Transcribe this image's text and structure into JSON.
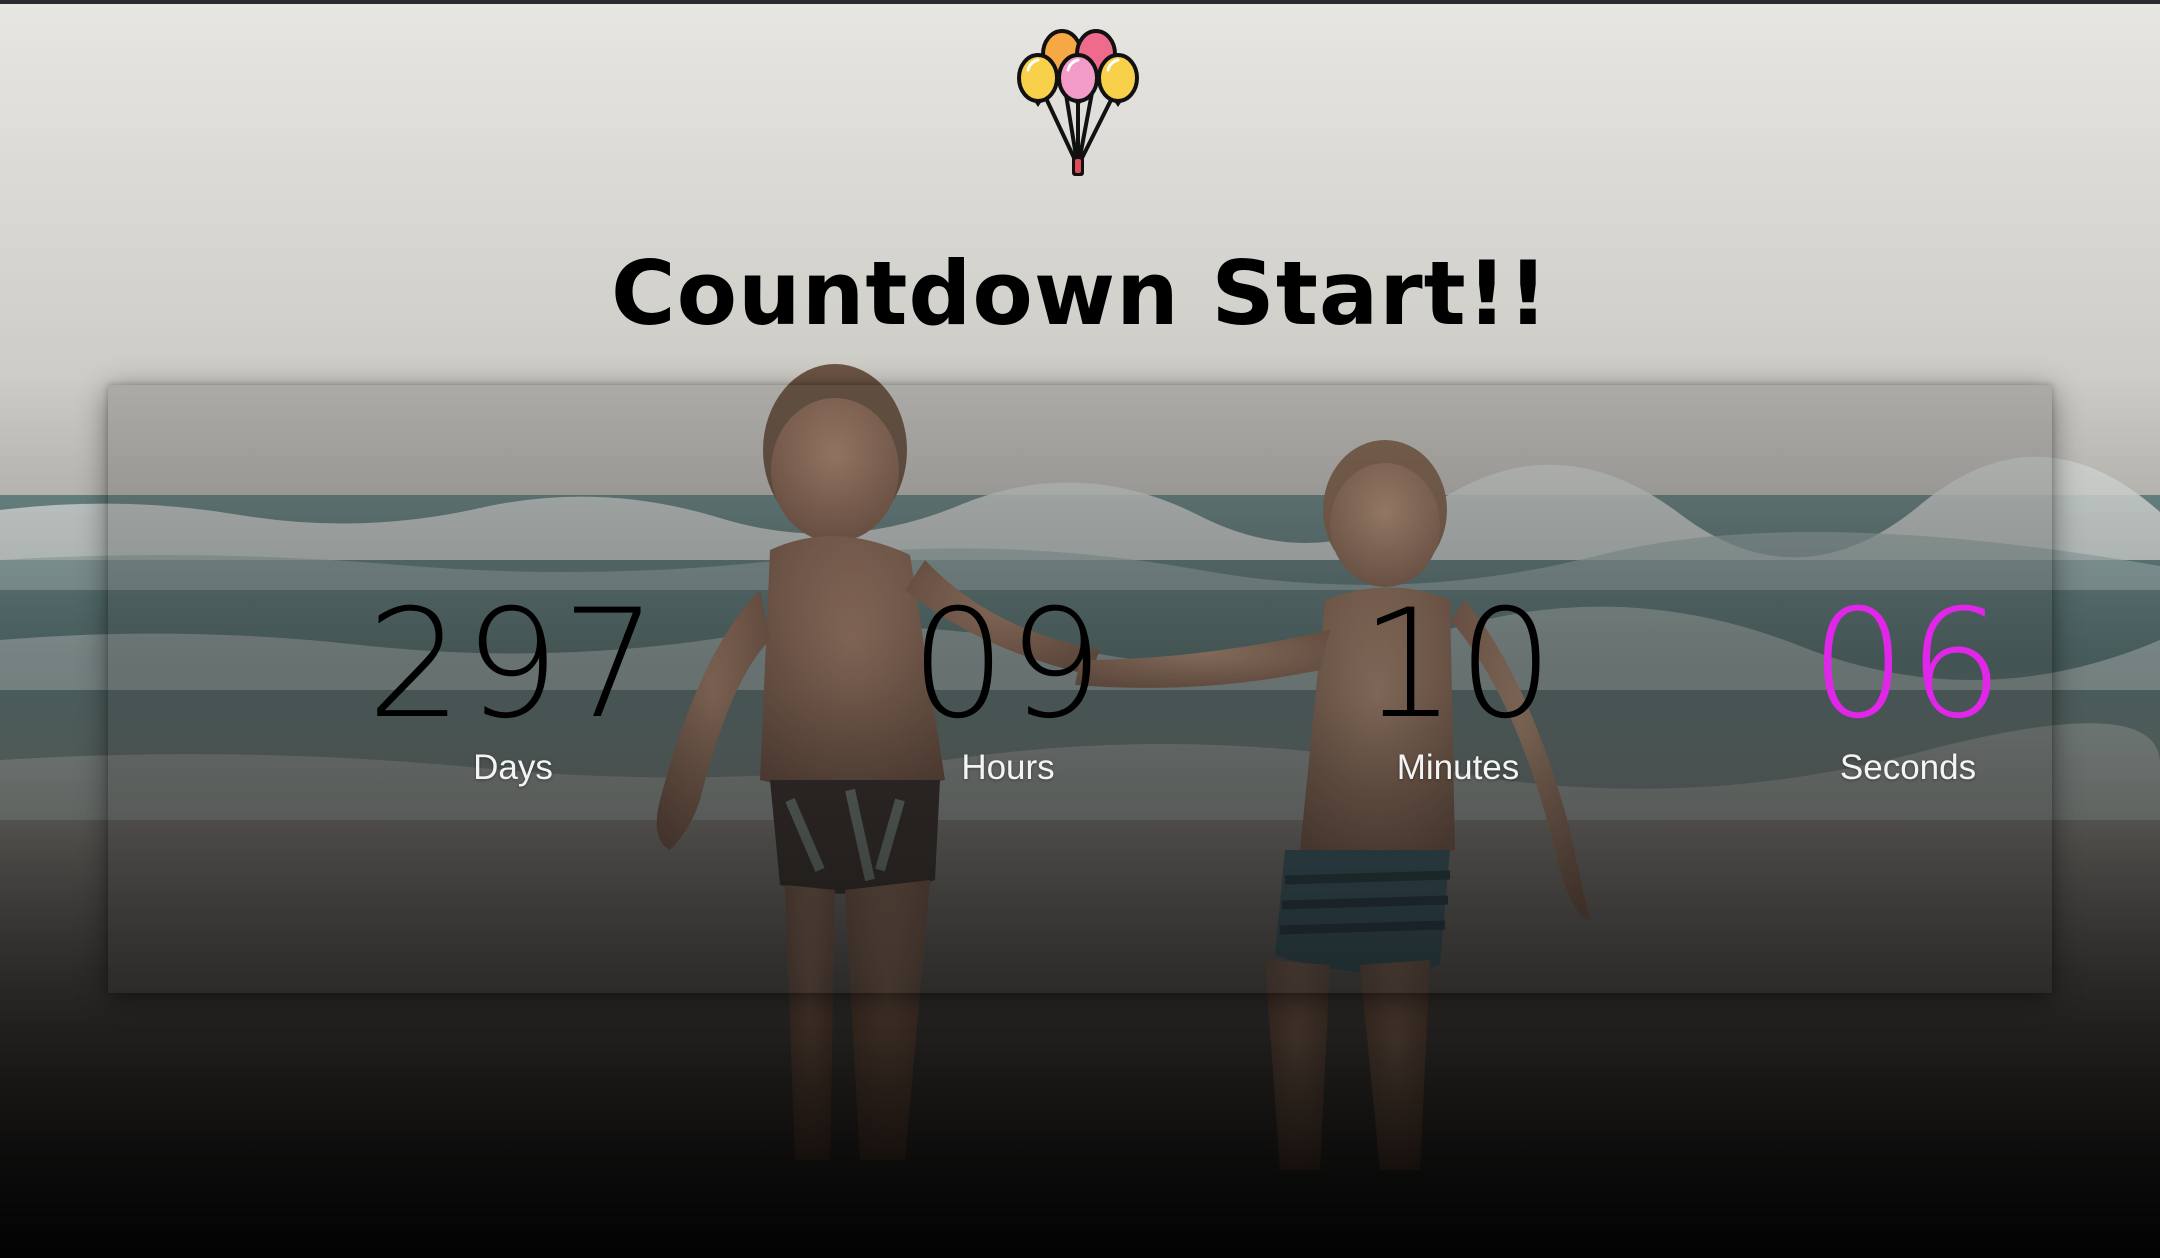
{
  "header": {
    "logo_icon": "balloons-icon",
    "title": "Countdown Start!!"
  },
  "countdown": {
    "days": {
      "value": "297",
      "label": "Days"
    },
    "hours": {
      "value": "09",
      "label": "Hours"
    },
    "minutes": {
      "value": "10",
      "label": "Minutes"
    },
    "seconds": {
      "value": "06",
      "label": "Seconds"
    }
  },
  "colors": {
    "seconds_accent": "#e026e8",
    "title": "#000000",
    "label": "#f4f4f4"
  }
}
